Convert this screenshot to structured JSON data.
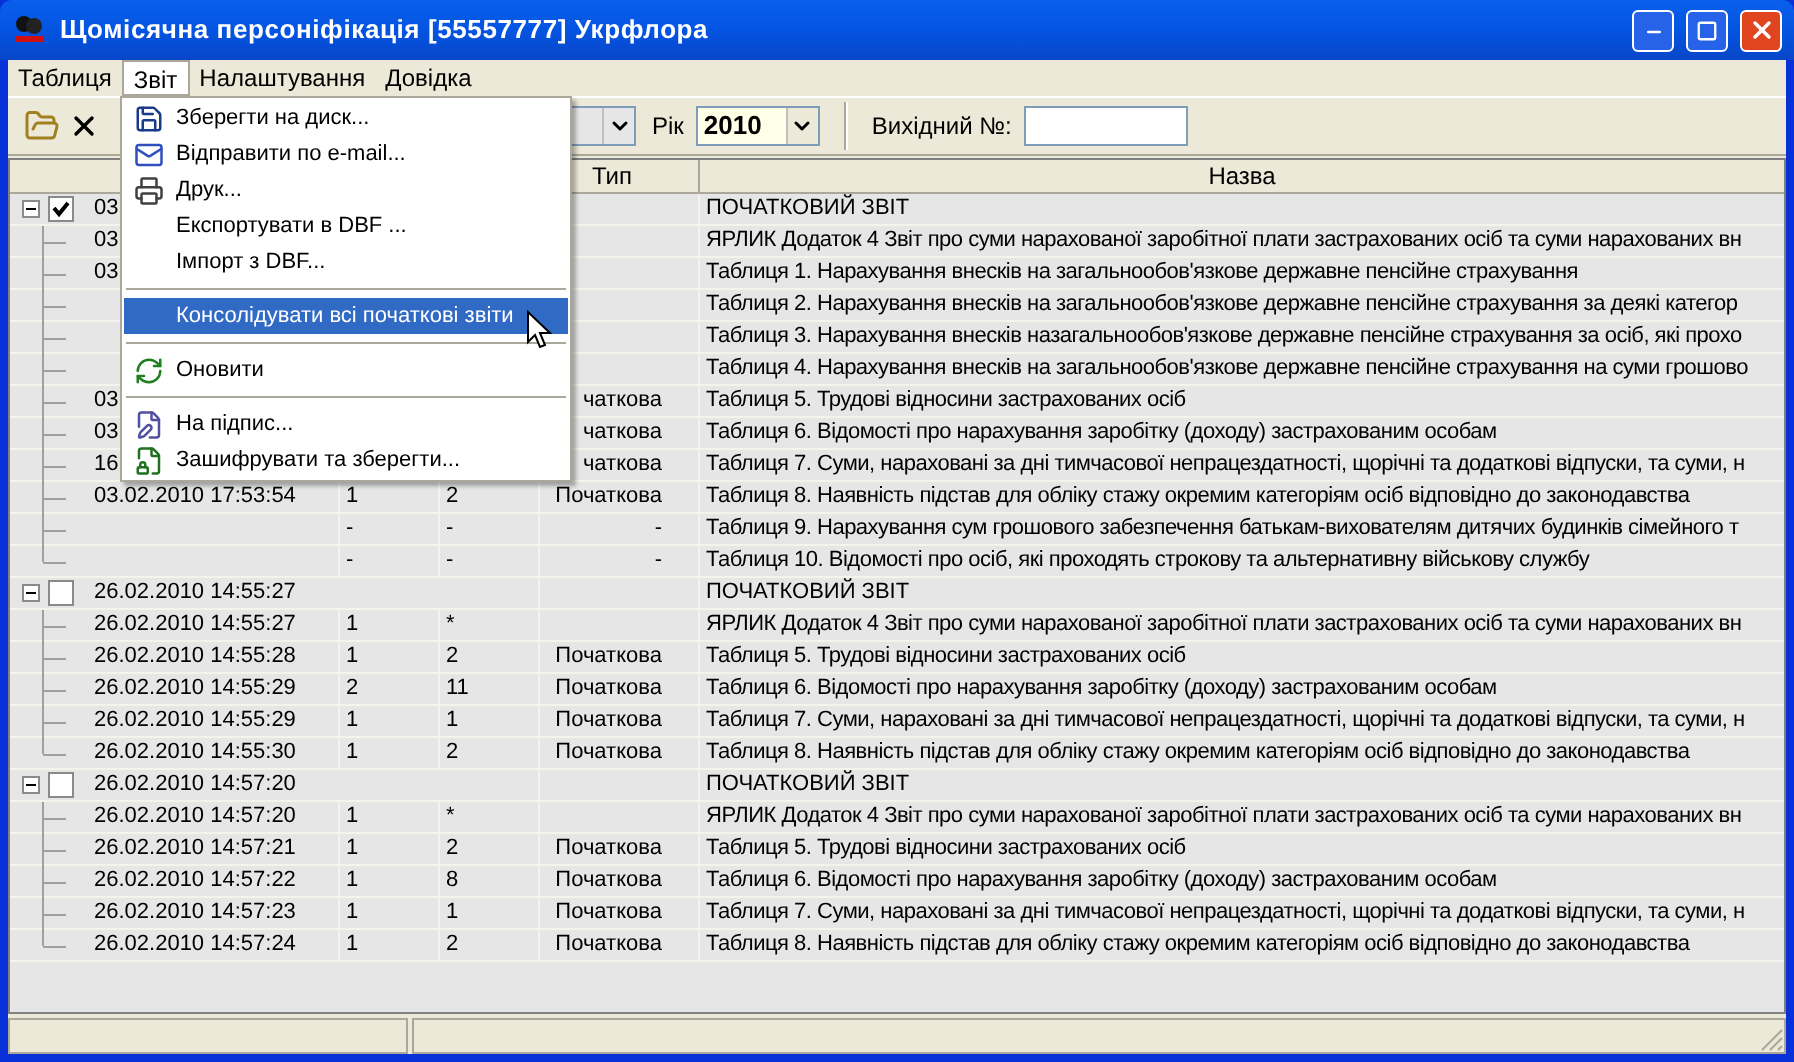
{
  "window": {
    "title": "Щомісячна персоніфікація [55557777] Укрфлора"
  },
  "menu_bar": [
    {
      "label": "Таблиця",
      "selected": false
    },
    {
      "label": "Звіт",
      "selected": true
    },
    {
      "label": "Налаштування",
      "selected": false
    },
    {
      "label": "Довідка",
      "selected": false
    }
  ],
  "toolbar": {
    "year_label": "Рік",
    "year": "2010",
    "number_label": "Вихідний №:"
  },
  "open_menu": {
    "items": [
      {
        "kind": "item",
        "label": "Зберегти на диск...",
        "selected": false
      },
      {
        "kind": "item",
        "label": "Відправити по e-mail...",
        "selected": false
      },
      {
        "kind": "item",
        "label": "Друк...",
        "selected": false
      },
      {
        "kind": "item",
        "label": "Експортувати в DBF ...",
        "selected": false
      },
      {
        "kind": "item",
        "label": "Імпорт з DBF...",
        "selected": false
      },
      {
        "kind": "separator"
      },
      {
        "kind": "item",
        "label": "Консолідувати всі початкові звіти",
        "selected": true
      },
      {
        "kind": "separator"
      },
      {
        "kind": "item",
        "label": "Оновити",
        "selected": false
      },
      {
        "kind": "separator"
      },
      {
        "kind": "item",
        "label": "На підпис...",
        "selected": false
      },
      {
        "kind": "item",
        "label": "Зашифрувати та зберегти...",
        "selected": false
      }
    ]
  },
  "table": {
    "columns": [
      "Тип",
      "Назва"
    ],
    "groups": [
      {
        "checked": true,
        "expanded": true,
        "date": "03",
        "name": "ПОЧАТКОВИЙ ЗВІТ",
        "rows": [
          {
            "date": "03",
            "name": "ЯРЛИК Додаток 4 Звіт про суми нарахованої заробітної плати застрахованих осіб та суми нарахованих вн"
          },
          {
            "date": "03",
            "name": "Таблиця 1. Нарахування внесків на загальнообов'язкове державне пенсійне страхування"
          },
          {
            "name": "Таблиця 2. Нарахування внесків на загальнообов'язкове державне пенсійне страхування за деякі категор"
          },
          {
            "name": "Таблиця 3. Нарахування внесків назагальнообов'язкове державне пенсійне страхування за осіб, які прохо"
          },
          {
            "name": "Таблиця 4. Нарахування внесків на загальнообов'язкове державне пенсійне страхування на суми грошово"
          },
          {
            "date": "03",
            "type": "чаткова",
            "name": "Таблиця 5. Трудові відносини застрахованих осіб"
          },
          {
            "date": "03",
            "type": "чаткова",
            "name": "Таблиця 6. Відомості про нарахування заробітку (доходу) застрахованим особам"
          },
          {
            "date": "16",
            "type": "чаткова",
            "name": "Таблиця 7. Суми, нараховані за дні тимчасової непрацездатності, щорічні та додаткові відпуски, та суми, н"
          },
          {
            "date": "03.02.2010 17:53:54",
            "column_3": "1",
            "column_4": "2",
            "type": "Початкова",
            "name": "Таблиця 8. Наявність підстав для обліку стажу окремим категоріям осіб відповідно до законодавства"
          },
          {
            "column_3": "-",
            "column_4": "-",
            "type": "-",
            "name": "Таблиця 9. Нарахування сум грошового забезпечення батькам-вихователям дитячих будинків сімейного т"
          },
          {
            "column_3": "-",
            "column_4": "-",
            "type": "-",
            "name": "Таблиця 10. Відомості про осіб, які проходять строкову та альтернативну військову службу"
          }
        ]
      },
      {
        "checked": false,
        "expanded": true,
        "date": "26.02.2010 14:55:27",
        "name": "ПОЧАТКОВИЙ ЗВІТ",
        "rows": [
          {
            "date": "26.02.2010 14:55:27",
            "column_3": "1",
            "column_4": "*",
            "name": "ЯРЛИК Додаток 4 Звіт про суми нарахованої заробітної плати застрахованих осіб та суми нарахованих вн"
          },
          {
            "date": "26.02.2010 14:55:28",
            "column_3": "1",
            "column_4": "2",
            "type": "Початкова",
            "name": "Таблиця 5. Трудові відносини застрахованих осіб"
          },
          {
            "date": "26.02.2010 14:55:29",
            "column_3": "2",
            "column_4": "11",
            "type": "Початкова",
            "name": "Таблиця 6. Відомості про нарахування заробітку (доходу) застрахованим особам"
          },
          {
            "date": "26.02.2010 14:55:29",
            "column_3": "1",
            "column_4": "1",
            "type": "Початкова",
            "name": "Таблиця 7. Суми, нараховані за дні тимчасової непрацездатності, щорічні та додаткові відпуски, та суми, н"
          },
          {
            "date": "26.02.2010 14:55:30",
            "column_3": "1",
            "column_4": "2",
            "type": "Початкова",
            "name": "Таблиця 8. Наявність підстав для обліку стажу окремим категоріям осіб відповідно до законодавства"
          }
        ]
      },
      {
        "checked": false,
        "expanded": true,
        "date": "26.02.2010 14:57:20",
        "name": "ПОЧАТКОВИЙ ЗВІТ",
        "rows": [
          {
            "date": "26.02.2010 14:57:20",
            "column_3": "1",
            "column_4": "*",
            "name": "ЯРЛИК Додаток 4 Звіт про суми нарахованої заробітної плати застрахованих осіб та суми нарахованих вн"
          },
          {
            "date": "26.02.2010 14:57:21",
            "column_3": "1",
            "column_4": "2",
            "type": "Початкова",
            "name": "Таблиця 5. Трудові відносини застрахованих осіб"
          },
          {
            "date": "26.02.2010 14:57:22",
            "column_3": "1",
            "column_4": "8",
            "type": "Початкова",
            "name": "Таблиця 6. Відомості про нарахування заробітку (доходу) застрахованим особам"
          },
          {
            "date": "26.02.2010 14:57:23",
            "column_3": "1",
            "column_4": "1",
            "type": "Початкова",
            "name": "Таблиця 7. Суми, нараховані за дні тимчасової непрацездатності, щорічні та додаткові відпуски, та суми, н"
          },
          {
            "date": "26.02.2010 14:57:24",
            "column_3": "1",
            "column_4": "2",
            "type": "Початкова",
            "name": "Таблиця 8. Наявність підстав для обліку стажу окремим категоріям осіб відповідно до законодавства"
          }
        ]
      }
    ]
  }
}
